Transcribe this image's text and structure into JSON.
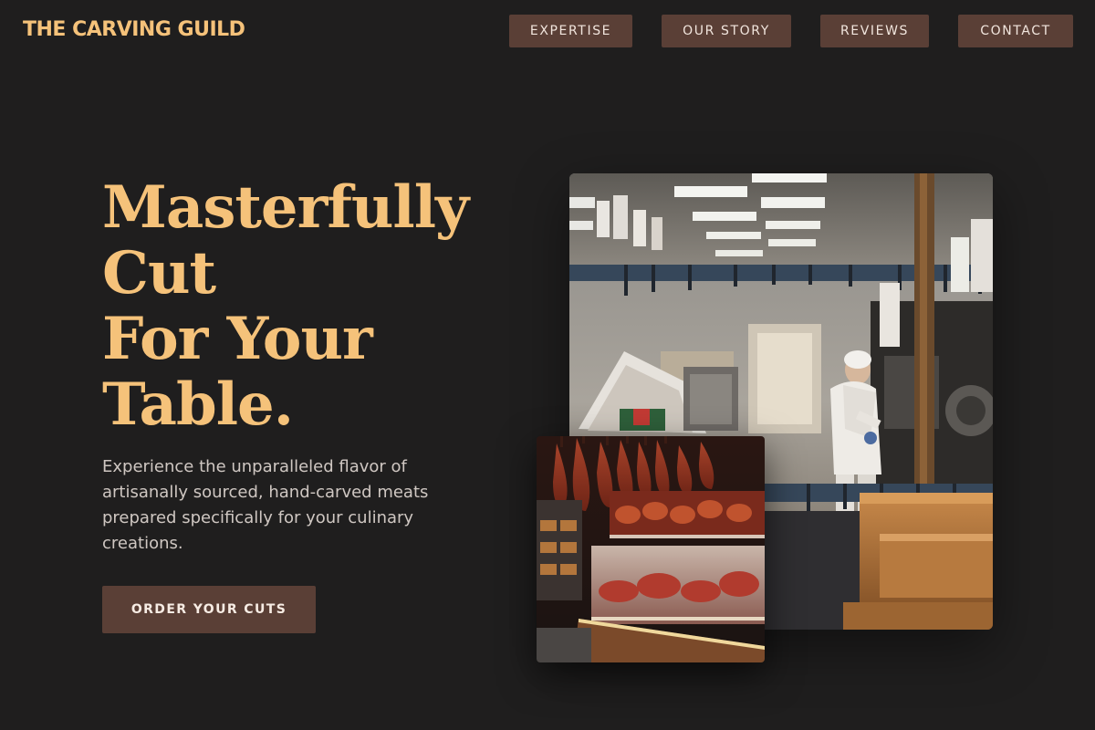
{
  "header": {
    "brand": "THE CARVING GUILD",
    "nav": {
      "expertise": "EXPERTISE",
      "our_story": "OUR STORY",
      "reviews": "REVIEWS",
      "contact": "CONTACT"
    }
  },
  "hero": {
    "headline_lines": [
      "Masterfully",
      "Cut",
      "For Your",
      "Table."
    ],
    "description": "Experience the unparalleled flavor of artisanally sourced, hand-carved meats prepared specifically for your culinary creations.",
    "cta_label": "ORDER YOUR CUTS"
  },
  "images": {
    "main": "butcher-shop-photo",
    "inset": "cured-meats-display-photo"
  },
  "colors": {
    "background": "#1f1e1e",
    "accent": "#f5c27a",
    "button": "#5a3f36",
    "body_text": "#cfc7c2"
  }
}
